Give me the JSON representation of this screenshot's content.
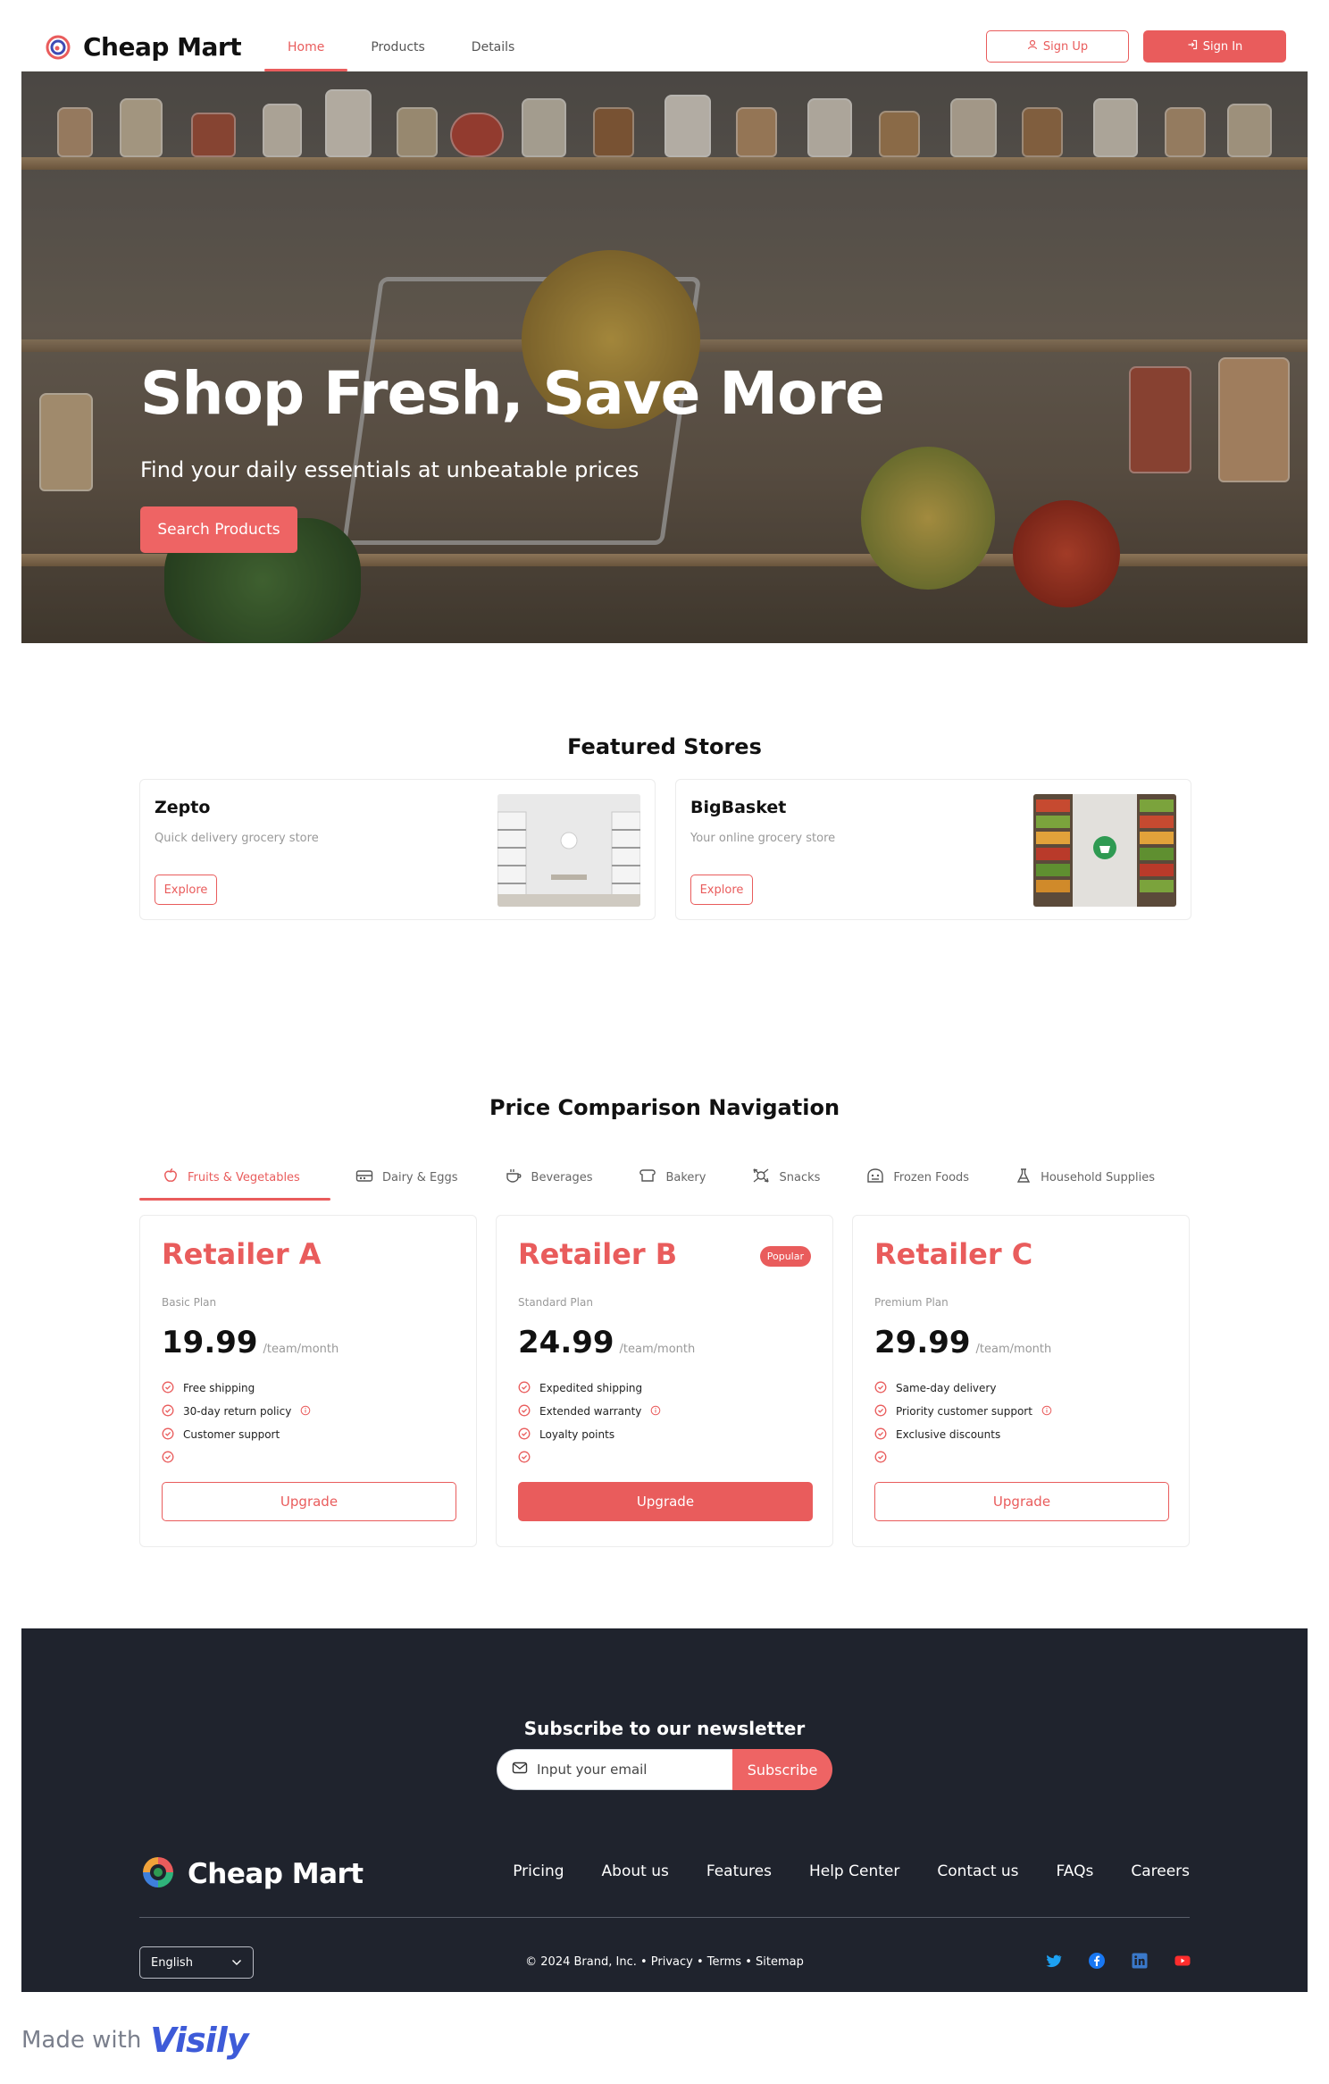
{
  "header": {
    "brand": "Cheap Mart",
    "nav": [
      {
        "label": "Home",
        "active": true
      },
      {
        "label": "Products",
        "active": false
      },
      {
        "label": "Details",
        "active": false
      }
    ],
    "signup_label": "Sign Up",
    "signin_label": "Sign In"
  },
  "hero": {
    "title": "Shop Fresh, Save More",
    "subtitle": "Find your daily essentials at unbeatable prices",
    "button_label": "Search Products"
  },
  "featured": {
    "title": "Featured Stores",
    "stores": [
      {
        "name": "Zepto",
        "description": "Quick delivery grocery store",
        "button": "Explore"
      },
      {
        "name": "BigBasket",
        "description": "Your online grocery store",
        "button": "Explore"
      }
    ]
  },
  "comparison": {
    "title": "Price Comparison Navigation",
    "tabs": [
      {
        "label": "Fruits & Vegetables",
        "icon": "apple-icon",
        "active": true
      },
      {
        "label": "Dairy & Eggs",
        "icon": "fridge-icon",
        "active": false
      },
      {
        "label": "Beverages",
        "icon": "cup-icon",
        "active": false
      },
      {
        "label": "Bakery",
        "icon": "bread-icon",
        "active": false
      },
      {
        "label": "Snacks",
        "icon": "candy-icon",
        "active": false
      },
      {
        "label": "Frozen Foods",
        "icon": "freezer-icon",
        "active": false
      },
      {
        "label": "Household Supplies",
        "icon": "flask-icon",
        "active": false
      }
    ],
    "plans": [
      {
        "name": "Retailer A",
        "badge": "",
        "tier": "Basic Plan",
        "price": "19.99",
        "period": "/team/month",
        "features": [
          "Free shipping",
          "30-day return policy",
          "Customer support",
          ""
        ],
        "button": "Upgrade",
        "primary": false
      },
      {
        "name": "Retailer B",
        "badge": "Popular",
        "tier": "Standard Plan",
        "price": "24.99",
        "period": "/team/month",
        "features": [
          "Expedited shipping",
          "Extended warranty",
          "Loyalty points",
          ""
        ],
        "button": "Upgrade",
        "primary": true
      },
      {
        "name": "Retailer C",
        "badge": "",
        "tier": "Premium Plan",
        "price": "29.99",
        "period": "/team/month",
        "features": [
          "Same-day delivery",
          "Priority customer support",
          "Exclusive discounts",
          ""
        ],
        "button": "Upgrade",
        "primary": false
      }
    ]
  },
  "footer": {
    "newsletter_title": "Subscribe to our newsletter",
    "email_placeholder": "Input your email",
    "subscribe_label": "Subscribe",
    "brand": "Cheap Mart",
    "links": [
      "Pricing",
      "About us",
      "Features",
      "Help Center",
      "Contact us",
      "FAQs",
      "Careers"
    ],
    "language": "English",
    "copyright": "© 2024 Brand, Inc. • Privacy • Terms • Sitemap",
    "social": [
      "twitter-icon",
      "facebook-icon",
      "linkedin-icon",
      "youtube-icon"
    ]
  },
  "badge": {
    "made_with": "Made with",
    "brand": "Visily"
  },
  "colors": {
    "accent": "#e95c5c",
    "footer_bg": "#1f232d",
    "text_dark": "#111111",
    "text_muted": "#999999"
  }
}
